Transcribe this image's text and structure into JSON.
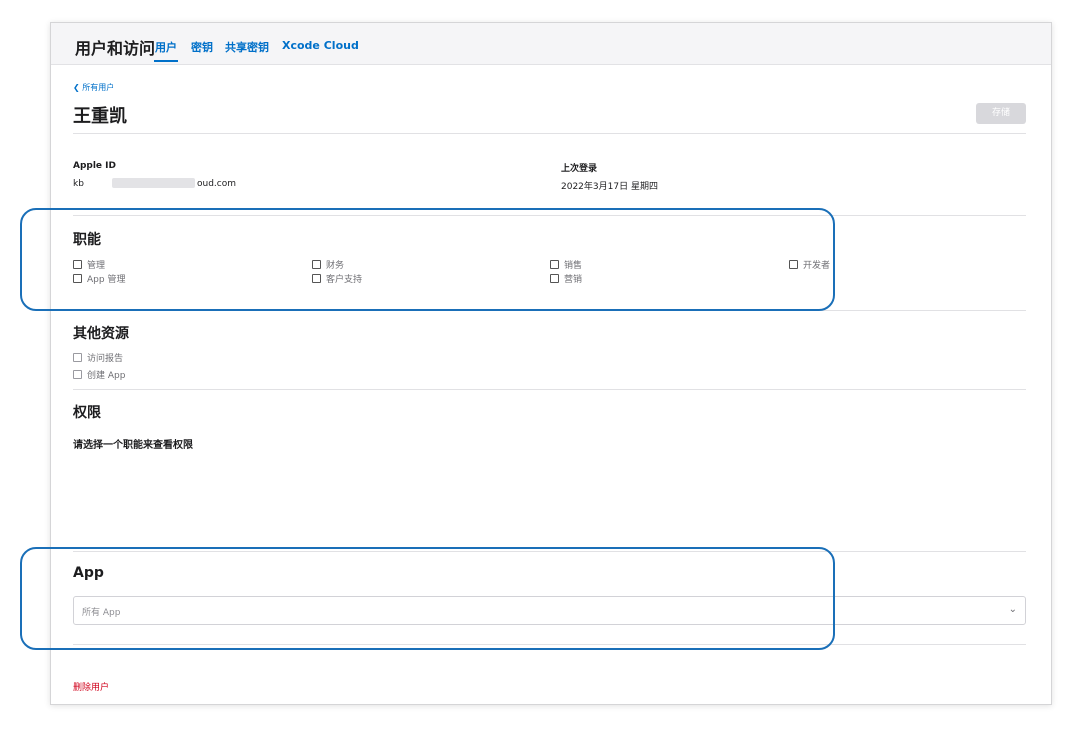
{
  "header": {
    "title": "用户和访问",
    "tabs": [
      {
        "label": "用户",
        "active": true
      },
      {
        "label": "密钥",
        "active": false
      },
      {
        "label": "共享密钥",
        "active": false
      },
      {
        "label": "Xcode Cloud",
        "active": false
      }
    ]
  },
  "page": {
    "back_link": "❮ 所有用户",
    "user_name": "王重凯",
    "save_label": "存储"
  },
  "details": {
    "apple_id_label": "Apple ID",
    "apple_id_prefix": "kb",
    "apple_id_suffix": "oud.com",
    "last_login_label": "上次登录",
    "last_login_value": "2022年3月17日 星期四"
  },
  "roles": {
    "title": "职能",
    "items": [
      "管理",
      "App 管理",
      "财务",
      "客户支持",
      "销售",
      "营销",
      "开发者"
    ]
  },
  "resources": {
    "title": "其他资源",
    "items": [
      "访问报告",
      "创建 App"
    ]
  },
  "permissions": {
    "title": "权限",
    "hint": "请选择一个职能来查看权限"
  },
  "apps": {
    "title": "App",
    "select_value": "所有 App"
  },
  "delete_label": "删除用户",
  "colors": {
    "accent": "#0070c9",
    "danger": "#d0021b",
    "callout": "#1a6fb8"
  }
}
